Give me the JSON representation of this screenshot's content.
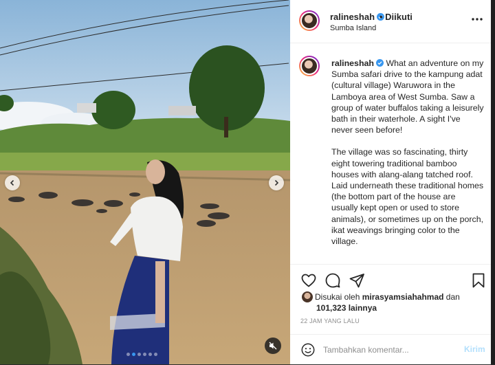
{
  "post": {
    "username": "ralineshah",
    "follow_status": "• Diikuti",
    "location": "Sumba Island",
    "caption_username": "ralineshah",
    "caption_p1": "What an adventure on my Sumba safari drive to the kampung adat (cultural village) Waruwora in the Lamboya area of West Sumba. Saw a group of water buffalos taking a leisurely bath in their waterhole. A sight I've never seen before!",
    "caption_p2": "The village was so fascinating, thirty eight towering traditional bamboo houses with alang-alang tatched roof. Laid underneath these traditional homes (the bottom part of the house are usually kept open or used to store animals), or sometimes up on the porch, ikat weavings bringing color to the village.",
    "likes_prefix": "Disukai oleh",
    "likes_user": "mirasyamsiahahmad",
    "likes_and": "dan",
    "likes_count": "101,323 lainnya",
    "timestamp": "22 JAM YANG LALU",
    "comment_placeholder": "Tambahkan komentar...",
    "post_button": "Kirim"
  },
  "media": {
    "carousel_slides": 6,
    "active_slide": 1
  },
  "icons": {
    "verified": "verified-badge-icon",
    "more": "more-options-icon",
    "like": "heart-icon",
    "comment": "comment-icon",
    "share": "paper-plane-icon",
    "save": "bookmark-icon",
    "emoji": "emoji-icon",
    "mute": "muted-speaker-icon",
    "prev": "chevron-left-icon",
    "next": "chevron-right-icon"
  },
  "colors": {
    "verified": "#3897f0",
    "post_button": "#b2dffc",
    "timestamp": "#8e8e8e"
  }
}
